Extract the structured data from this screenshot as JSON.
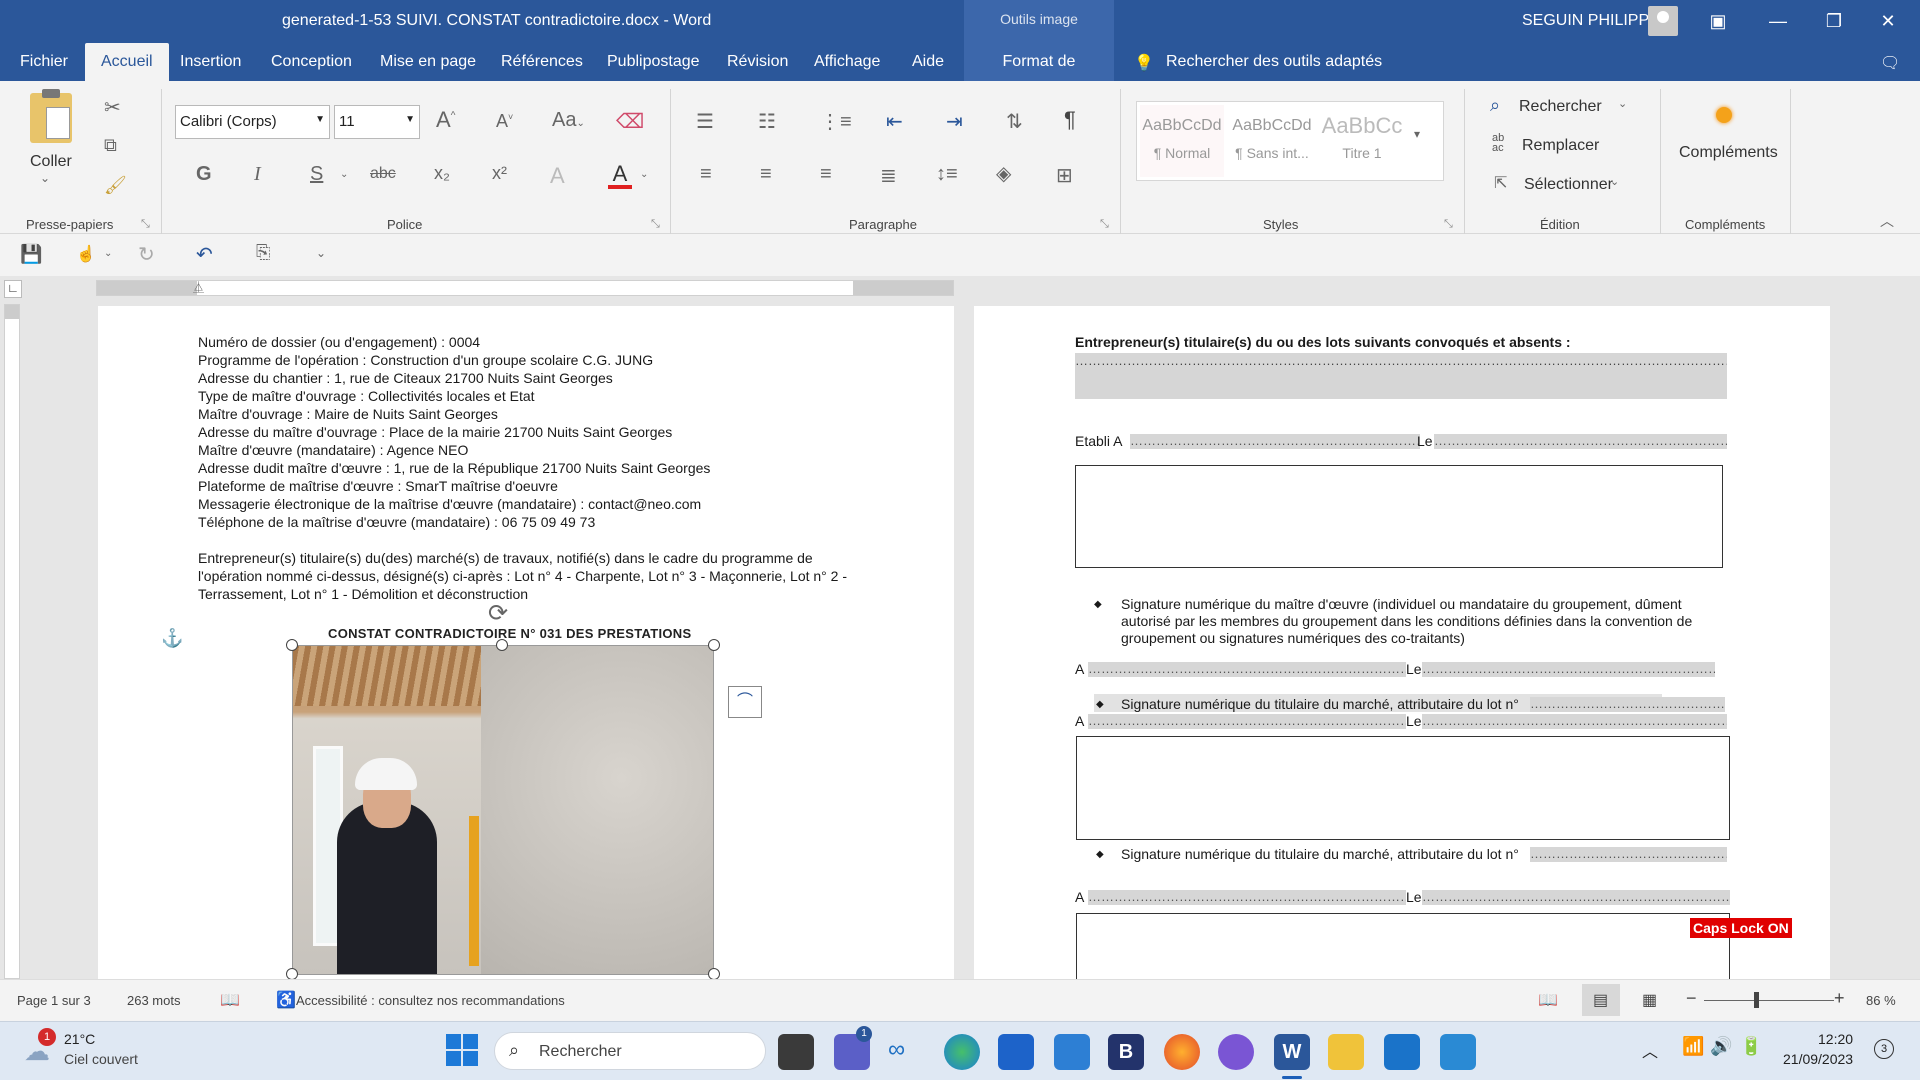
{
  "window": {
    "title": "generated-1-53  SUIVI. CONSTAT contradictoire.docx  -  Word",
    "contextual_tab_header": "Outils image",
    "user": "SEGUIN PHILIPPE"
  },
  "menu": {
    "items": [
      "Fichier",
      "Accueil",
      "Insertion",
      "Conception",
      "Mise en page",
      "Références",
      "Publipostage",
      "Révision",
      "Affichage",
      "Aide",
      "Format de l'image"
    ],
    "active": "Accueil",
    "search_tools": "Rechercher des outils adaptés"
  },
  "ribbon": {
    "clipboard": {
      "paste_label": "Coller",
      "group_label": "Presse-papiers"
    },
    "font": {
      "font_name": "Calibri (Corps)",
      "font_size": "11",
      "group_label": "Police",
      "case_label": "Aa",
      "bold": "G",
      "italic": "I",
      "underline": "S",
      "strike": "abc",
      "sub": "x₂",
      "sup": "x²",
      "font_color": "A",
      "text_effects": "A",
      "font_color_hex": "#e02020"
    },
    "paragraph": {
      "group_label": "Paragraphe"
    },
    "styles": {
      "group_label": "Styles",
      "items": [
        {
          "preview": "AaBbCcDd",
          "label": "¶ Normal"
        },
        {
          "preview": "AaBbCcDd",
          "label": "¶ Sans int..."
        },
        {
          "preview": "AaBbCc",
          "label": "Titre 1"
        }
      ]
    },
    "editing": {
      "group_label": "Édition",
      "find": "Rechercher",
      "replace": "Remplacer",
      "select": "Sélectionner",
      "replace_icon_letters": "ab\nac"
    },
    "addins": {
      "label": "Compléments",
      "group_label": "Compléments"
    }
  },
  "left_page": {
    "lines": [
      "Numéro de dossier (ou d'engagement) : 0004",
      "Programme de l'opération : Construction d'un groupe scolaire C.G. JUNG",
      "Adresse du chantier : 1, rue de Citeaux 21700 Nuits Saint Georges",
      "Type de maître d'ouvrage : Collectivités locales et Etat",
      "Maître d'ouvrage : Maire de Nuits Saint Georges",
      "Adresse du maître d'ouvrage : Place de la mairie 21700 Nuits Saint Georges",
      "Maître d'œuvre (mandataire) : Agence NEO",
      "Adresse dudit maître d'œuvre : 1, rue de la République 21700 Nuits Saint Georges",
      "Plateforme de maîtrise d'œuvre : SmarT maîtrise d'oeuvre",
      "Messagerie électronique de la maîtrise d'œuvre (mandataire) : contact@neo.com",
      "Téléphone de la maîtrise d'œuvre (mandataire) : 06 75 09 49 73"
    ],
    "paragraph": "Entrepreneur(s) titulaire(s) du(des) marché(s) de travaux, notifié(s) dans le cadre du programme de l'opération nommé ci-dessus, désigné(s) ci-après : Lot n° 4 - Charpente, Lot n° 3 - Maçonnerie, Lot n° 2 - Terrassement, Lot n° 1 - Démolition et déconstruction",
    "constat_title": "CONSTAT CONTRADICTOIRE N° 031 DES PRESTATIONS"
  },
  "right_page": {
    "absent_heading": "Entrepreneur(s) titulaire(s) du ou des lots suivants convoqués et absents :",
    "etabli_a": "Etabli A",
    "le": "Le",
    "a": "A",
    "sig_moe": "Signature numérique du maître d'œuvre (individuel ou mandataire du groupement, dûment autorisé par les membres du groupement dans les conditions définies dans la convention de groupement ou signatures numériques des co-traitants)",
    "sig_titulaire": "Signature numérique du titulaire du marché, attributaire du lot n°",
    "caps_lock": "Caps Lock ON"
  },
  "status": {
    "page": "Page 1 sur 3",
    "words": "263 mots",
    "accessibility": "Accessibilité : consultez nos recommandations",
    "zoom": "86 %"
  },
  "taskbar": {
    "weather_temp": "21°C",
    "weather_desc": "Ciel couvert",
    "weather_badge": "1",
    "search_placeholder": "Rechercher",
    "clock_time": "12:20",
    "clock_date": "21/09/2023",
    "notif_count": "3",
    "teams_badge": "1"
  }
}
